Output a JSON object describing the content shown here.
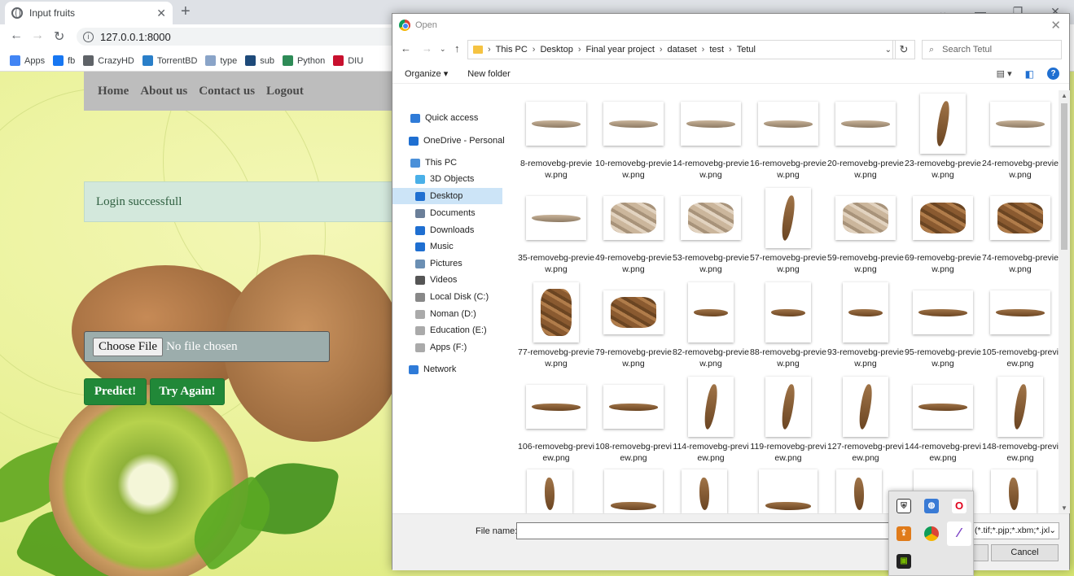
{
  "browser": {
    "tab_title": "Input fruits",
    "tab_close": "✕",
    "new_tab": "+",
    "url": "127.0.0.1:8000",
    "bookmarks": [
      {
        "label": "Apps",
        "icon": "apps-grid-icon",
        "color": "#4285f4"
      },
      {
        "label": "fb",
        "icon": "facebook-icon",
        "color": "#1877f2"
      },
      {
        "label": "CrazyHD",
        "icon": "globe-icon",
        "color": "#5f6368"
      },
      {
        "label": "TorrentBD",
        "icon": "torrentbd-icon",
        "color": "#2a7fc9"
      },
      {
        "label": "type",
        "icon": "type-icon",
        "color": "#8aa4c8"
      },
      {
        "label": "sub",
        "icon": "subscene-icon",
        "color": "#1e4a7a"
      },
      {
        "label": "Python",
        "icon": "python-icon",
        "color": "#2e8b57"
      },
      {
        "label": "DIU",
        "icon": "diu-icon",
        "color": "#c8102e"
      }
    ]
  },
  "page": {
    "nav": [
      "Home",
      "About us",
      "Contact us",
      "Logout"
    ],
    "alert": "Login successfull",
    "choose_file": "Choose File",
    "no_file": "No file chosen",
    "predict": "Predict!",
    "try_again": "Try Again!"
  },
  "dialog": {
    "title": "Open",
    "breadcrumb": [
      "This PC",
      "Desktop",
      "Final year project",
      "dataset",
      "test",
      "Tetul"
    ],
    "search_placeholder": "Search Tetul",
    "organize": "Organize ▾",
    "new_folder": "New folder",
    "nav_items": [
      {
        "label": "Quick access",
        "icon": "star-icon"
      },
      {
        "label": "OneDrive - Personal",
        "icon": "cloud-icon"
      },
      {
        "label": "This PC",
        "icon": "computer-icon"
      },
      {
        "label": "3D Objects",
        "icon": "cube-icon"
      },
      {
        "label": "Desktop",
        "icon": "desktop-icon"
      },
      {
        "label": "Documents",
        "icon": "documents-icon"
      },
      {
        "label": "Downloads",
        "icon": "download-icon"
      },
      {
        "label": "Music",
        "icon": "music-icon"
      },
      {
        "label": "Pictures",
        "icon": "pictures-icon"
      },
      {
        "label": "Videos",
        "icon": "videos-icon"
      },
      {
        "label": "Local Disk (C:)",
        "icon": "disk-icon"
      },
      {
        "label": "Noman (D:)",
        "icon": "disk-icon"
      },
      {
        "label": "Education (E:)",
        "icon": "disk-icon"
      },
      {
        "label": "Apps (F:)",
        "icon": "disk-icon"
      },
      {
        "label": "Network",
        "icon": "network-icon"
      }
    ],
    "selected_nav": "Desktop",
    "files": [
      "8-removebg-preview.png",
      "10-removebg-preview.png",
      "14-removebg-preview.png",
      "16-removebg-preview.png",
      "20-removebg-preview.png",
      "23-removebg-preview.png",
      "24-removebg-preview.png",
      "35-removebg-preview.png",
      "49-removebg-preview.png",
      "53-removebg-preview.png",
      "57-removebg-preview.png",
      "59-removebg-preview.png",
      "69-removebg-preview.png",
      "74-removebg-preview.png",
      "77-removebg-preview.png",
      "79-removebg-preview.png",
      "82-removebg-preview.png",
      "88-removebg-preview.png",
      "93-removebg-preview.png",
      "95-removebg-preview.png",
      "105-removebg-preview.png",
      "106-removebg-preview.png",
      "108-removebg-preview.png",
      "114-removebg-preview.png",
      "119-removebg-preview.png",
      "127-removebg-preview.png",
      "144-removebg-preview.png",
      "148-removebg-preview.png"
    ],
    "file_name_label": "File name:",
    "file_name_value": "",
    "file_type": "(*.tif;*.pjp;*.xbm;*.jxl",
    "cancel": "Cancel"
  }
}
